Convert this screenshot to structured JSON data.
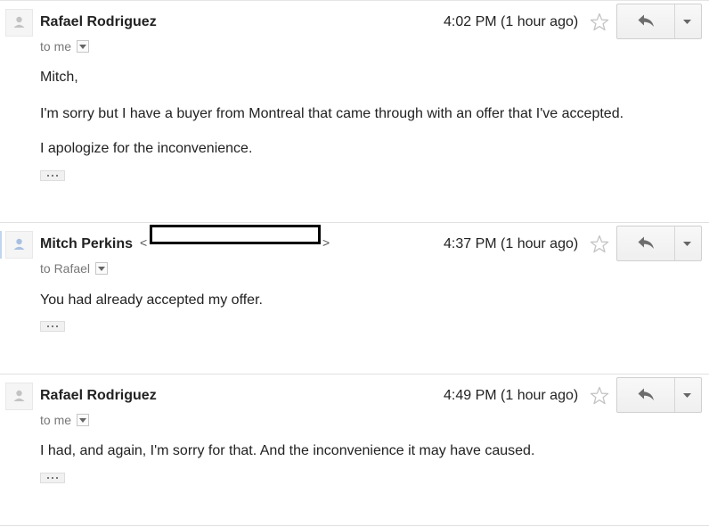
{
  "messages": [
    {
      "sender": "Rafael Rodriguez",
      "sender_email_open": "",
      "sender_email_close": "",
      "recipient": "to me",
      "time": "4:02 PM (1 hour ago)",
      "body": [
        "Mitch,",
        "I'm sorry but I have a buyer from Montreal that  came through with an offer that I've accepted.",
        "I apologize for the inconvenience."
      ]
    },
    {
      "sender": "Mitch Perkins",
      "sender_email_open": "<",
      "sender_email_close": ">",
      "recipient": "to Rafael",
      "time": "4:37 PM (1 hour ago)",
      "body": [
        "You had already accepted my offer."
      ]
    },
    {
      "sender": "Rafael Rodriguez",
      "sender_email_open": "",
      "sender_email_close": "",
      "recipient": "to me",
      "time": "4:49 PM (1 hour ago)",
      "body": [
        "I had, and again, I'm sorry for that. And the inconvenience it may have caused."
      ]
    }
  ],
  "icons": {
    "avatar": "person-icon",
    "details": "chevron-down-icon",
    "star": "star-icon",
    "reply": "reply-icon",
    "more": "dropdown-arrow-icon",
    "trimmed": "ellipsis-icon"
  },
  "colors": {
    "text": "#222222",
    "muted": "#777777",
    "divider": "#e0e0e0",
    "button_border": "#d0d0d0"
  }
}
